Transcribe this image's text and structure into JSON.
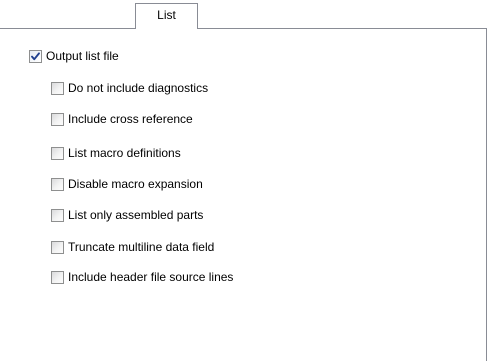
{
  "tabs": [
    {
      "label": "List",
      "selected": true
    }
  ],
  "output_list_file": {
    "label": "Output list file",
    "checked": true
  },
  "options": [
    {
      "label": "Do not include diagnostics",
      "checked": false
    },
    {
      "label": "Include cross reference",
      "checked": false
    },
    {
      "label": "List macro definitions",
      "checked": false
    },
    {
      "label": "Disable macro expansion",
      "checked": false
    },
    {
      "label": "List only assembled parts",
      "checked": false
    },
    {
      "label": "Truncate multiline data field",
      "checked": false
    },
    {
      "label": "Include header file source lines",
      "checked": false
    }
  ],
  "colors": {
    "border": "#898c95",
    "checkmark": "#1f3f8f",
    "background": "#ffffff"
  }
}
